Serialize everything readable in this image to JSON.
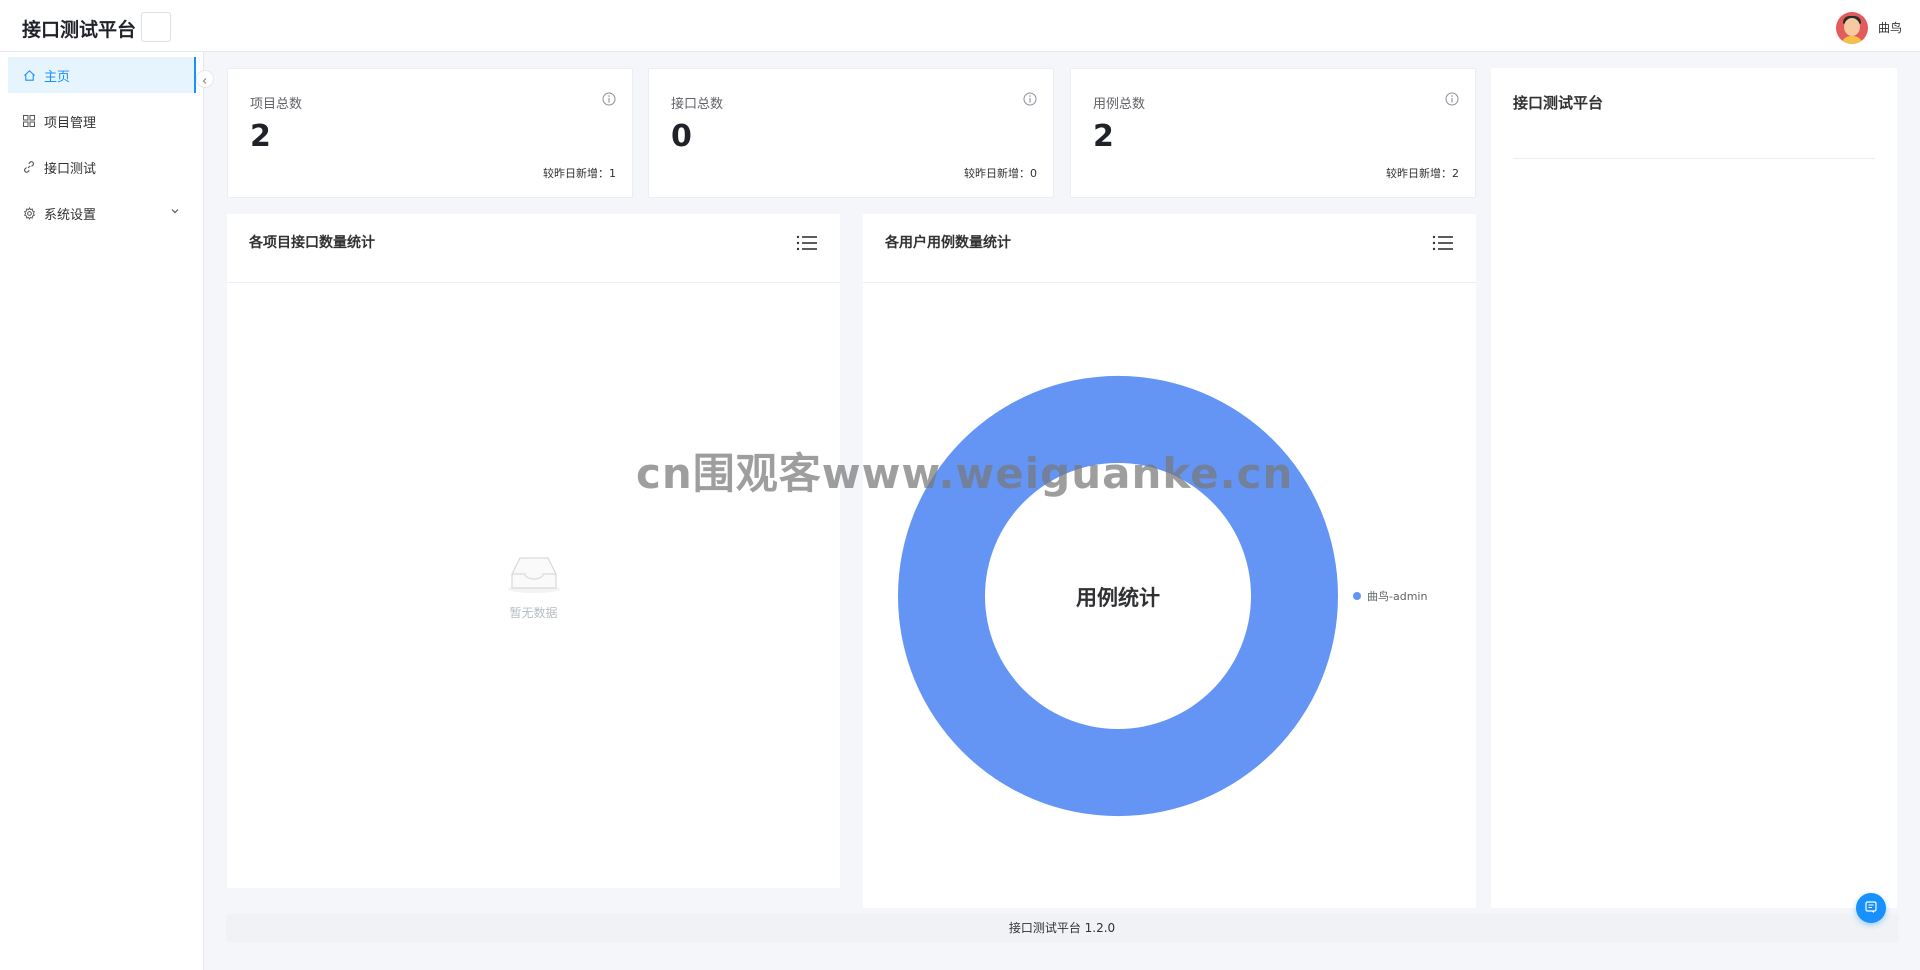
{
  "header": {
    "app_title": "接口测试平台",
    "username": "曲鸟"
  },
  "sidebar": {
    "items": [
      {
        "label": "主页",
        "icon": "home-icon",
        "active": true
      },
      {
        "label": "项目管理",
        "icon": "grid-icon",
        "active": false
      },
      {
        "label": "接口测试",
        "icon": "link-icon",
        "active": false
      },
      {
        "label": "系统设置",
        "icon": "gear-icon",
        "active": false,
        "expandable": true
      }
    ]
  },
  "stats": [
    {
      "label": "项目总数",
      "value": "2",
      "sub": "较昨日新增：1"
    },
    {
      "label": "接口总数",
      "value": "0",
      "sub": "较昨日新增：0"
    },
    {
      "label": "用例总数",
      "value": "2",
      "sub": "较昨日新增：2"
    }
  ],
  "panels": {
    "project_api": {
      "title": "各项目接口数量统计",
      "empty_text": "暂无数据"
    },
    "user_cases": {
      "title": "各用户用例数量统计",
      "center_label": "用例统计"
    }
  },
  "right_panel": {
    "title": "接口测试平台"
  },
  "footer": {
    "text": "接口测试平台 1.2.0"
  },
  "watermark": {
    "text": "cn围观客www.weiguanke.cn"
  },
  "colors": {
    "accent": "#1890ff",
    "donut": "#6495f5"
  },
  "chart_data": {
    "type": "pie",
    "title": "用例统计",
    "categories": [
      "曲鸟-admin"
    ],
    "values": [
      2
    ],
    "legend": "right"
  }
}
